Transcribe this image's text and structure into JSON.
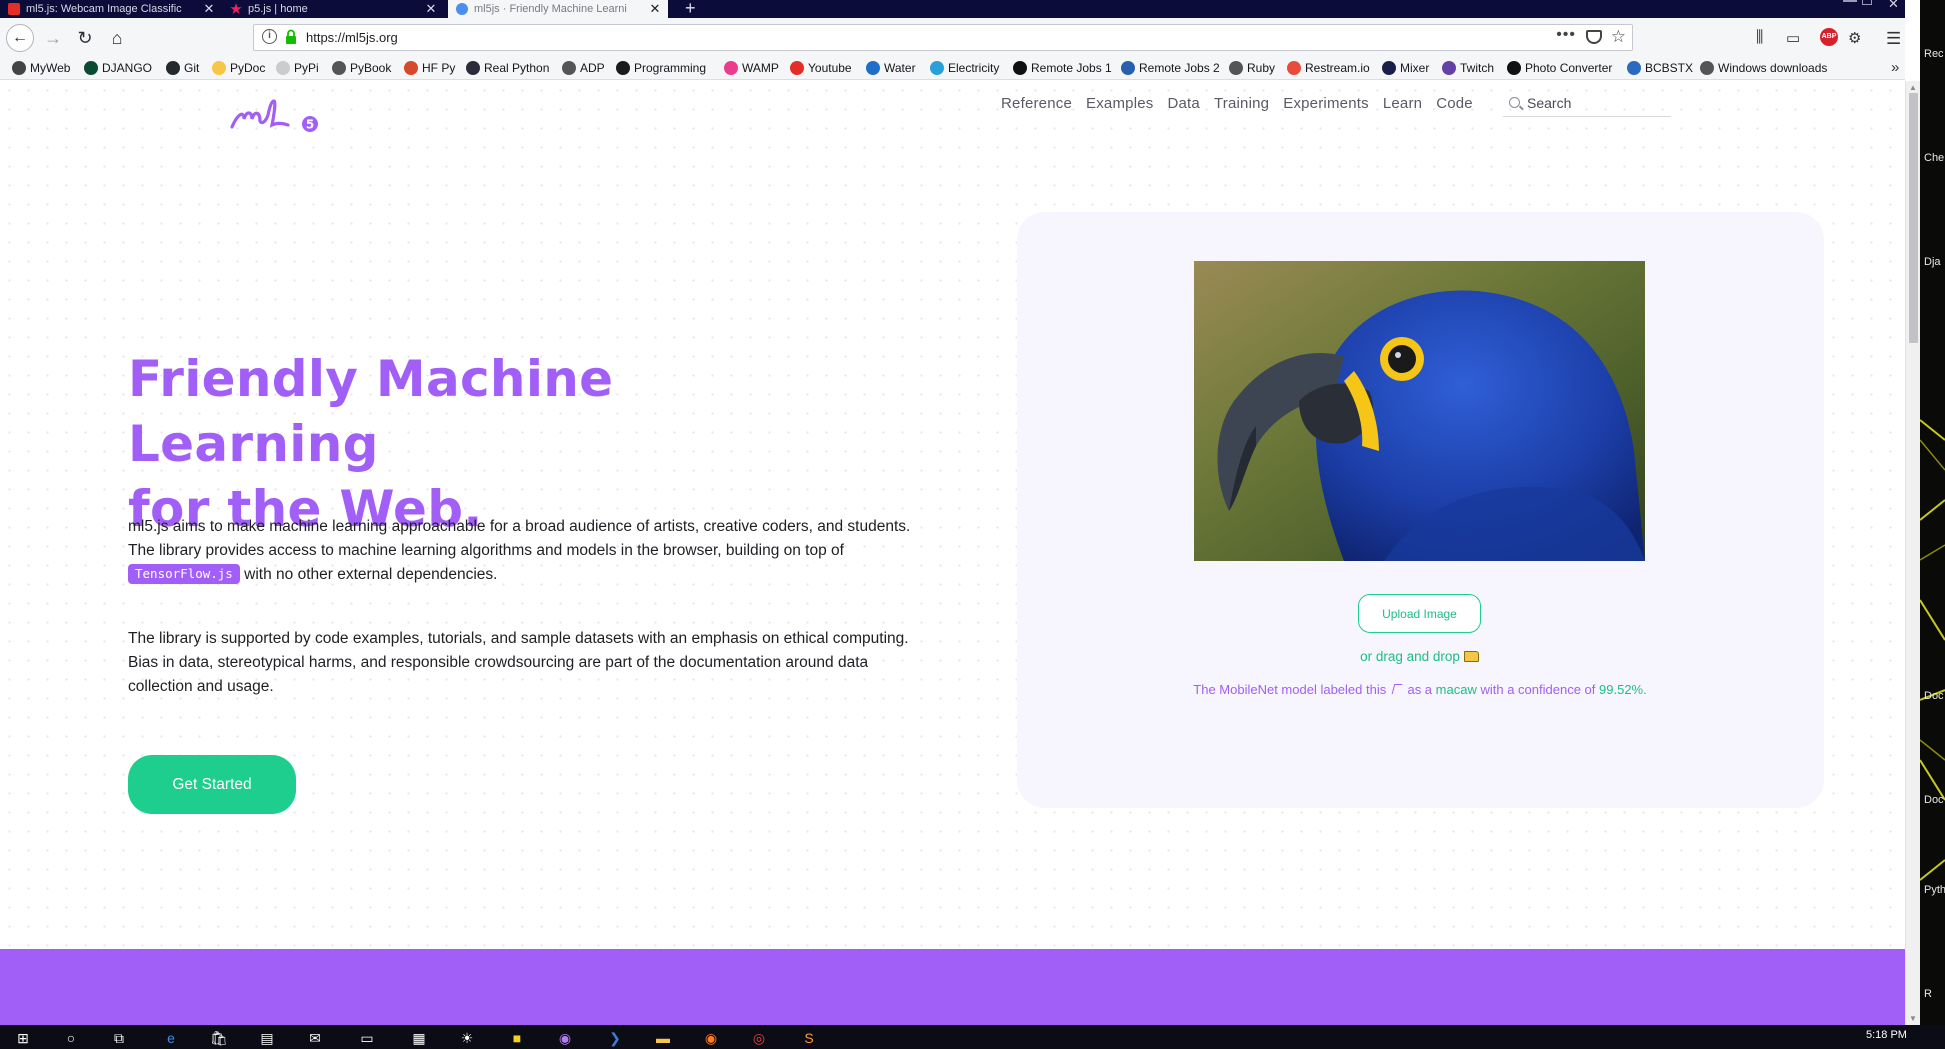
{
  "browser": {
    "tabs": [
      {
        "title": "ml5.js: Webcam Image Classific",
        "favicon_color": "#e52d27",
        "active": false
      },
      {
        "title": "p5.js | home",
        "favicon_color": "#ed225d",
        "active": false
      },
      {
        "title": "ml5js · Friendly Machine Learni",
        "favicon_color": "#4a8ff0",
        "active": true
      }
    ],
    "url": "https://ml5js.org",
    "bookmarks": [
      {
        "label": "MyWeb",
        "icon_color": "#444444"
      },
      {
        "label": "DJANGO",
        "icon_color": "#0c4b33"
      },
      {
        "label": "Git",
        "icon_color": "#24292e"
      },
      {
        "label": "PyDoc",
        "icon_color": "#f6c744"
      },
      {
        "label": "PyPi",
        "icon_color": "#cccccc"
      },
      {
        "label": "PyBook",
        "icon_color": "#555555"
      },
      {
        "label": "HF Py",
        "icon_color": "#d44a2a"
      },
      {
        "label": "Real Python",
        "icon_color": "#2b2b3a"
      },
      {
        "label": "ADP",
        "icon_color": "#555555"
      },
      {
        "label": "Programming",
        "icon_color": "#1b1b1b"
      },
      {
        "label": "WAMP",
        "icon_color": "#e83e8c"
      },
      {
        "label": "Youtube",
        "icon_color": "#e52d27"
      },
      {
        "label": "Water",
        "icon_color": "#1f6fc8"
      },
      {
        "label": "Electricity",
        "icon_color": "#2aa0d8"
      },
      {
        "label": "Remote Jobs 1",
        "icon_color": "#111111"
      },
      {
        "label": "Remote Jobs 2",
        "icon_color": "#2a5fb0"
      },
      {
        "label": "Ruby",
        "icon_color": "#555555"
      },
      {
        "label": "Restream.io",
        "icon_color": "#e84b3c"
      },
      {
        "label": "Mixer",
        "icon_color": "#1a1f4a"
      },
      {
        "label": "Twitch",
        "icon_color": "#6441a5"
      },
      {
        "label": "Photo Converter",
        "icon_color": "#111111"
      },
      {
        "label": "BCBSTX",
        "icon_color": "#2a6bbf"
      },
      {
        "label": "Windows downloads",
        "icon_color": "#555555"
      }
    ]
  },
  "site": {
    "logo_text": "ml5",
    "nav": [
      "Reference",
      "Examples",
      "Data",
      "Training",
      "Experiments",
      "Learn",
      "Code"
    ],
    "search_placeholder": "Search",
    "headline_line1": "Friendly Machine Learning",
    "headline_line2": "for the Web.",
    "para1_before": "ml5.js aims to make machine learning approachable for a broad audience of artists, creative coders, and students. The library provides access to machine learning algorithms and models in the browser, building on top of ",
    "para1_code": "TensorFlow.js",
    "para1_after": " with no other external dependencies.",
    "para2": "The library is supported by code examples, tutorials, and sample datasets with an emphasis on ethical computing. Bias in data, stereotypical harms, and responsible crowdsourcing are part of the documentation around data collection and usage.",
    "cta": "Get Started",
    "demo": {
      "upload_label": "Upload Image",
      "drag_text": "or drag and drop",
      "result_prefix": "The MobileNet model labeled this",
      "result_mid": "as a",
      "result_label": "macaw",
      "result_conf_text": "with a confidence of",
      "result_confidence": "99.52%."
    },
    "colors": {
      "accent_purple": "#a15ff7",
      "accent_green": "#1dce8e"
    }
  },
  "desktop": {
    "labels": [
      "Rec",
      "Che",
      "Dja",
      "Doc",
      "Doc",
      "Pyth",
      "R"
    ]
  },
  "taskbar": {
    "clock": "5:18 PM"
  }
}
